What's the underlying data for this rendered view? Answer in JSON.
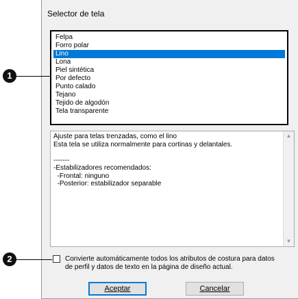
{
  "dialog": {
    "title": "Selector de tela",
    "fabrics": [
      {
        "label": "Felpa",
        "selected": false
      },
      {
        "label": "Forro polar",
        "selected": false
      },
      {
        "label": "Lino",
        "selected": true
      },
      {
        "label": "Lona",
        "selected": false
      },
      {
        "label": "Piel sintética",
        "selected": false
      },
      {
        "label": "Por defecto",
        "selected": false
      },
      {
        "label": "Punto calado",
        "selected": false
      },
      {
        "label": "Tejano",
        "selected": false
      },
      {
        "label": "Tejido de algodón",
        "selected": false
      },
      {
        "label": "Tela transparente",
        "selected": false
      }
    ],
    "description_lines": [
      "Ajuste para telas trenzadas, como el lino",
      "Esta tela se utiliza normalmente para cortinas y delantales.",
      "",
      "-------",
      "-Estabilizadores recomendados:",
      "  -Frontal: ninguno",
      "  -Posterior: estabilizador separable"
    ],
    "checkbox": {
      "label_line1": "Convierte automáticamente todos los atributos de costura para datos",
      "label_line2": "de perfil y datos de texto en la página de diseño actual.",
      "checked": false
    },
    "buttons": {
      "ok_label": "Aceptar",
      "cancel_label": "Cancelar"
    }
  },
  "callouts": {
    "list": "1",
    "checkbox": "2"
  },
  "colors": {
    "selection": "#0078d7",
    "dialog_bg": "#f0f0f0"
  }
}
